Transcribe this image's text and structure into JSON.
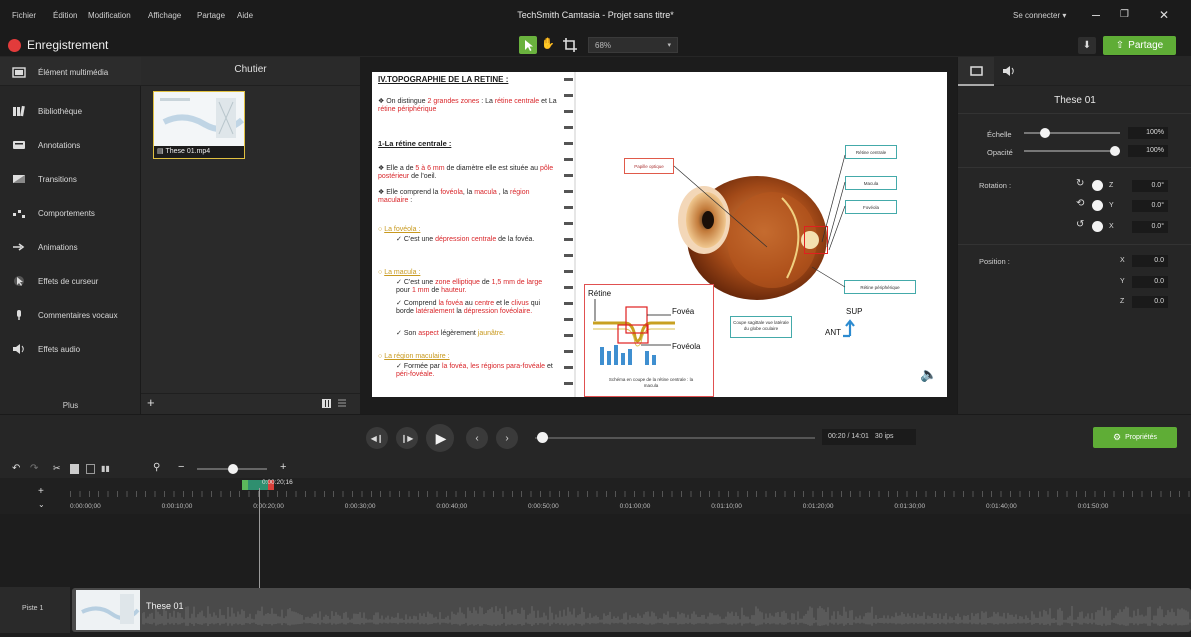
{
  "app": {
    "title": "TechSmith Camtasia - Projet sans titre*",
    "menu": [
      "Fichier",
      "Édition",
      "Modification",
      "Affichage",
      "Partage",
      "Aide"
    ],
    "sign_in": "Se connecter ▾"
  },
  "toolbar": {
    "record_label": "Enregistrement",
    "zoom": "68%",
    "share_label": "Partage"
  },
  "sidebar": {
    "items": [
      {
        "label": "Élément multimédia",
        "icon": "media-icon"
      },
      {
        "label": "Bibliothèque",
        "icon": "library-icon"
      },
      {
        "label": "Annotations",
        "icon": "annotation-icon"
      },
      {
        "label": "Transitions",
        "icon": "transition-icon"
      },
      {
        "label": "Comportements",
        "icon": "behavior-icon"
      },
      {
        "label": "Animations",
        "icon": "animation-icon"
      },
      {
        "label": "Effets de curseur",
        "icon": "cursor-icon"
      },
      {
        "label": "Commentaires vocaux",
        "icon": "microphone-icon"
      },
      {
        "label": "Effets audio",
        "icon": "speaker-icon"
      }
    ],
    "more_label": "Plus"
  },
  "bin": {
    "title": "Chutier",
    "media": [
      {
        "name": "These 01.mp4"
      }
    ]
  },
  "slide": {
    "title": "IV.TOPOGRAPHIE DE LA RETINE :",
    "p1a": "On distingue ",
    "p1b": "2 grandes zones",
    "p1c": " : La ",
    "p1d": "rétine centrale",
    "p1e": " et La ",
    "p1f": "rétine périphérique",
    "h2": "1-La rétine centrale :",
    "p2a": "Elle a de ",
    "p2b": "5 à 6 mm",
    "p2c": " de diamètre elle est située au ",
    "p2d": "pôle postérieur",
    "p2e": " de l'oeil.",
    "p3a": "Elle comprend la ",
    "p3b": "fovéola",
    "p3c": ", la ",
    "p3d": "macula",
    "p3e": " , la ",
    "p3f": "région maculaire",
    "p3g": " :",
    "h_fov": "La fovéola :",
    "fov1a": "C'est une ",
    "fov1b": "dépression centrale",
    "fov1c": " de la fovéa.",
    "h_mac": "La macula :",
    "mac1a": "C'est une ",
    "mac1b": "zone elliptique",
    "mac1c": " de ",
    "mac1d": "1,5 mm de large",
    "mac1e": " pour ",
    "mac1f": "1 mm",
    "mac1g": " de ",
    "mac1h": "hauteur.",
    "mac2a": "Comprend ",
    "mac2b": "la fovéa",
    "mac2c": " au ",
    "mac2d": "centre",
    "mac2e": " et le ",
    "mac2f": "clivus",
    "mac2g": " qui borde ",
    "mac2h": "latéralement",
    "mac2i": " la ",
    "mac2j": "dépression fovéolaire.",
    "mac3a": "Son ",
    "mac3b": "aspect",
    "mac3c": " légèrement ",
    "mac3d": "jaunâtre.",
    "h_reg": "La région maculaire :",
    "reg1a": "Formée par ",
    "reg1b": "la fovéa",
    "reg1c": ", les régions para-fovéale",
    "reg1d": " et ",
    "reg1e": "péri-fovéale.",
    "lbl_papille": "Papille optique",
    "lbl_retine_centrale": "Rétine centrale",
    "lbl_macula": "Macula",
    "lbl_foveola": "Fovéola",
    "lbl_retine_peripherique": "Rétine périphérique",
    "lbl_coupe": "Coupe sagittale vue latérale du globe oculaire",
    "lbl_sup": "SUP",
    "lbl_ant": "ANT",
    "diag_retine": "Rétine",
    "diag_fovea": "Fovéa",
    "diag_foveola": "Fovéola",
    "diag_caption": "Schéma en coupe de la rétine centrale : la macula"
  },
  "properties": {
    "title": "These 01",
    "scale_label": "Échelle",
    "scale_value": "100%",
    "scale": 1.0,
    "opacity_label": "Opacité",
    "opacity_value": "100%",
    "opacity": 1.0,
    "rotation_label": "Rotation :",
    "rotation": [
      {
        "axis": "Z",
        "value": "0.0°"
      },
      {
        "axis": "Y",
        "value": "0.0°"
      },
      {
        "axis": "X",
        "value": "0.0°"
      }
    ],
    "position_label": "Position :",
    "position": [
      {
        "axis": "X",
        "value": "0.0"
      },
      {
        "axis": "Y",
        "value": "0.0"
      },
      {
        "axis": "Z",
        "value": "0.0"
      }
    ]
  },
  "playback": {
    "time": "00:20 / 14:01",
    "fps": "30 ips",
    "props_button": "Propriétés",
    "progress": 0.024
  },
  "timeline": {
    "playhead_time": "0:00:20;16",
    "ticks": [
      "0:00:00;00",
      "0:00:10;00",
      "0:00:20;00",
      "0:00:30;00",
      "0:00:40;00",
      "0:00:50;00",
      "0:01:00;00",
      "0:01:10;00",
      "0:01:20;00",
      "0:01:30;00",
      "0:01:40;00",
      "0:01:50;00"
    ],
    "track_label": "Piste 1",
    "clip_name": "These 01"
  }
}
